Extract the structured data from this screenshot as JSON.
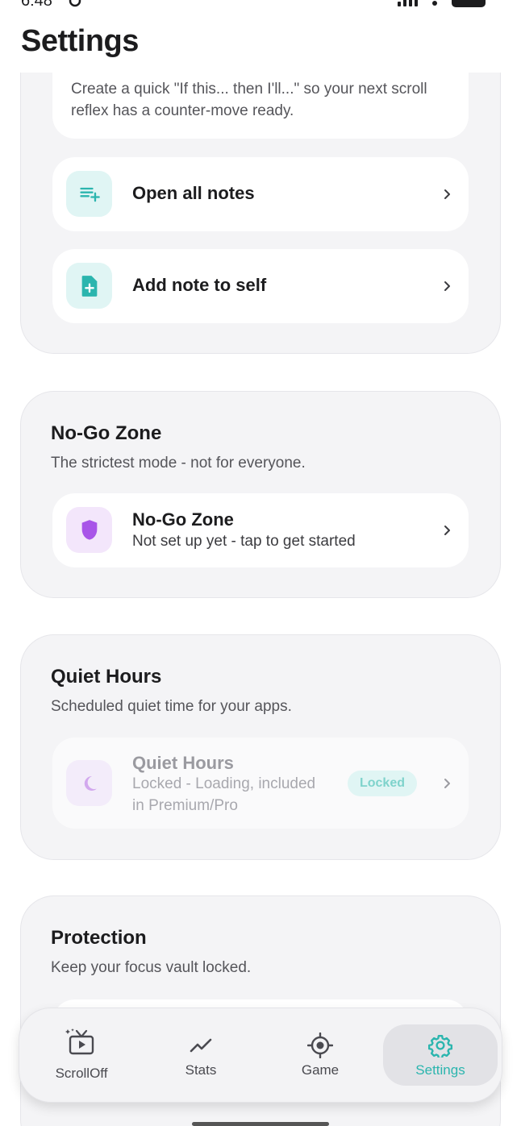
{
  "status_bar": {
    "time": "6:48"
  },
  "header": {
    "title": "Settings"
  },
  "notes_section": {
    "intro": "Create a quick \"If this... then I'll...\" so your next scroll reflex has a counter-move ready.",
    "rows": [
      {
        "label": "Open all notes",
        "icon": "playlist-add-icon"
      },
      {
        "label": "Add note to self",
        "icon": "note-add-icon"
      }
    ]
  },
  "nogo_section": {
    "title": "No-Go Zone",
    "subtitle": "The strictest mode - not for everyone.",
    "row": {
      "title": "No-Go Zone",
      "subtitle": "Not set up yet - tap to get started",
      "icon": "shield-icon"
    }
  },
  "quiet_section": {
    "title": "Quiet Hours",
    "subtitle": "Scheduled quiet time for your apps.",
    "row": {
      "title": "Quiet Hours",
      "subtitle_line1": "Locked - Loading, included",
      "subtitle_line2": "in Premium/Pro",
      "badge": "Locked",
      "icon": "moon-icon"
    }
  },
  "protection_section": {
    "title": "Protection",
    "subtitle": "Keep your focus vault locked."
  },
  "bottom_nav": {
    "items": [
      {
        "label": "ScrollOff",
        "icon": "tv-sparkle-icon"
      },
      {
        "label": "Stats",
        "icon": "trend-line-icon"
      },
      {
        "label": "Game",
        "icon": "target-icon"
      },
      {
        "label": "Settings",
        "icon": "gear-icon",
        "active": true
      }
    ]
  },
  "colors": {
    "accent": "#2bb5ae",
    "accent_bg": "#e0f5f4",
    "nogo_purple": "#a855e8",
    "nogo_bg": "#f3e6fb",
    "section_bg": "#f4f4f6"
  }
}
